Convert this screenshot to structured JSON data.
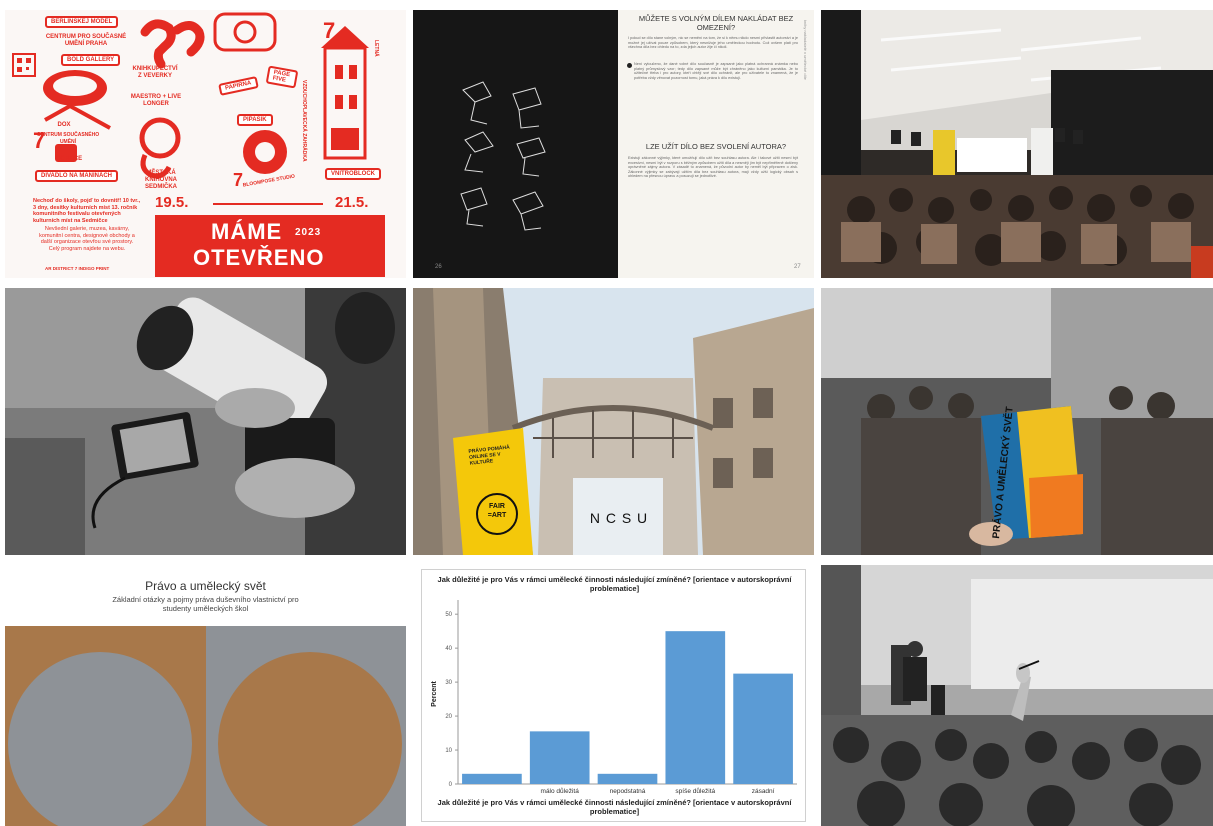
{
  "poster": {
    "labels": {
      "berlinskej_model": "BERLINSKEJ MODEL",
      "centrum": "CENTRUM PRO SOUČASNÉ UMĚNÍ PRAHA",
      "bold_gallery": "BOLD GALLERY",
      "knihkupectvi": "KNIHKUPECTVÍ Z VEVERKY",
      "maestro": "MAESTRO + LIVE LONGER",
      "papirna": "PAPÍRNA",
      "page_five": "PAGE FIVE",
      "pipasik": "PIPASIK",
      "dox": "DOX",
      "dox_arc": "CENTRUM SOUČASNÉHO UMĚNÍ",
      "coffice": "COFFICE",
      "divadlo": "DIVADLO NA MANINÁCH",
      "mestska": "MĚSTSKÁ KNIHOVNA SEDMIČKA",
      "bloomfilm": "BLOOMPOSE STUDIO",
      "vnitroblock": "VNITROBLOCK",
      "letna": "LETNÁ",
      "vzduchoplavecka": "VZDUCHOPLAVECKÁ ZAHRÁDKA"
    },
    "intro": "Nechoď do školy, pojď to dovnitř! 10 tvr., 3 dny, desítky kulturních míst 13. ročník komunitního festivalu otevřených kulturních míst na Sedmičce",
    "body": "Nevšední galerie, muzea, kavárny, komunitní centra, designové obchody a další organizace otevřou své prostory. Celý program najdete na webu.",
    "date_start": "19.5.",
    "date_end": "21.5.",
    "headline1": "MÁME",
    "year": "2023",
    "headline2": "OTEVŘENO",
    "footer": "AR DISTRICT 7 INDIGO PRINT"
  },
  "book": {
    "heading1": "MŮŽETE S VOLNÝM DÍLEM NAKLÁDAT BEZ OMEZENÍ?",
    "para1": "I pokud se dílo stane volným, nic se nemění na tom, že si k němu nikdo nesmí přivlastit autorství a je možné jej užívat pouze způsobem, který nesnižuje jeho uměleckou hodnotu. Což ovšem platí pro všechna díla bez ohledu na to, zda jejich autor žije či nikoli.",
    "para2": "Není vyloučeno, že dané volné dílo současně je zapsané jako platná ochranná známka nebo platný průmyslový vzor; tedy dílo zapsané může být chráněno jako kulturní památka. Je to užitečné třeba i pro autory, kteří chtějí své dílo ochránit, ale pro uživatele to znamená, že je potřeba vždy věnovat pozornost tomu, jaká práva k dílu existují.",
    "heading2": "LZE UŽÍT DÍLO BEZ SVOLENÍ AUTORA?",
    "para3": "Existují zákonné výjimky, které umožňují dílo užít bez souhlasu autora. Ale i takové užití nesmí být excesivní, nesmí být v rozporu s běžným způsobem užití díla a nesmějí jím být nepřiměřeně dotčeny oprávněné zájmy autora. V zásadě to znamená, že původní autor by neměl být připraven o zisk. Zákonné výjimky se zabývají užitím díla bez souhlasu autora, mají vždy užší logický obsah s ohledem na přesnou úpravu a posuzují se jednotlivé.",
    "side_left": "knihy nakladatelé v umělecké díle",
    "page_left": "26",
    "page_right": "27"
  },
  "banner": {
    "text": "PRÁVO POMÁHÁ ONLINE SE V KULTUŘE",
    "logo_line1": "FAIR",
    "logo_line2": "=ART",
    "building_sign": "N C S U"
  },
  "booklet": {
    "title": "PRÁVO A UMĚLECKÝ SVĚT"
  },
  "presentation": {
    "title": "Právo a umělecký svět",
    "subtitle": "Základní otázky a pojmy práva duševního vlastnictví pro studenty uměleckých škol"
  },
  "chart_data": {
    "type": "bar",
    "title": "Jak důležité je pro Vás v rámci umělecké činnosti následující zmíněné? [orientace v autorskoprávní problematice]",
    "xlabel": "Jak důležité je pro Vás v rámci umělecké činnosti následující zmíněné? [orientace v autorskoprávní problematice]",
    "ylabel": "Percent",
    "categories": [
      "",
      "málo důležitá",
      "nepodstatná",
      "spíše důležitá",
      "zásadní"
    ],
    "values": [
      3,
      15.5,
      3,
      45,
      32.5
    ],
    "yticks": [
      0,
      10,
      20,
      30,
      40,
      50
    ],
    "ylim": [
      0,
      53
    ],
    "bar_color": "#5b9bd5"
  },
  "colors": {
    "poster_red": "#e42b22",
    "banner_yellow": "#f4c80a",
    "slide_brown": "#a8784a",
    "slide_gray": "#8e9297"
  }
}
